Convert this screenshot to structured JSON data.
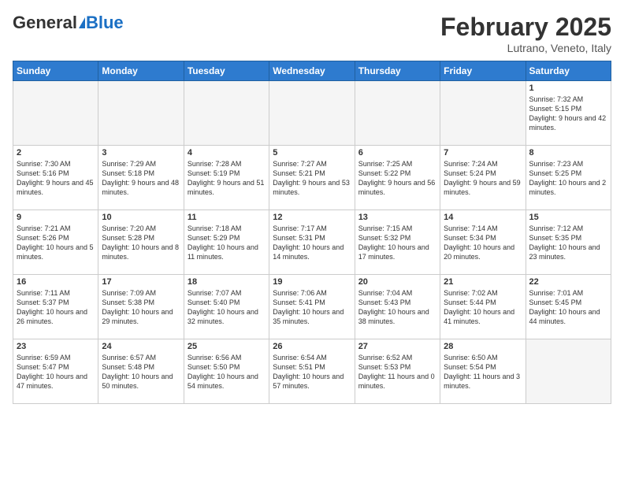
{
  "header": {
    "logo_general": "General",
    "logo_blue": "Blue",
    "month": "February 2025",
    "location": "Lutrano, Veneto, Italy"
  },
  "weekdays": [
    "Sunday",
    "Monday",
    "Tuesday",
    "Wednesday",
    "Thursday",
    "Friday",
    "Saturday"
  ],
  "weeks": [
    [
      {
        "day": "",
        "sunrise": "",
        "sunset": "",
        "daylight": ""
      },
      {
        "day": "",
        "sunrise": "",
        "sunset": "",
        "daylight": ""
      },
      {
        "day": "",
        "sunrise": "",
        "sunset": "",
        "daylight": ""
      },
      {
        "day": "",
        "sunrise": "",
        "sunset": "",
        "daylight": ""
      },
      {
        "day": "",
        "sunrise": "",
        "sunset": "",
        "daylight": ""
      },
      {
        "day": "",
        "sunrise": "",
        "sunset": "",
        "daylight": ""
      },
      {
        "day": "1",
        "sunrise": "Sunrise: 7:32 AM",
        "sunset": "Sunset: 5:15 PM",
        "daylight": "Daylight: 9 hours and 42 minutes."
      }
    ],
    [
      {
        "day": "2",
        "sunrise": "Sunrise: 7:30 AM",
        "sunset": "Sunset: 5:16 PM",
        "daylight": "Daylight: 9 hours and 45 minutes."
      },
      {
        "day": "3",
        "sunrise": "Sunrise: 7:29 AM",
        "sunset": "Sunset: 5:18 PM",
        "daylight": "Daylight: 9 hours and 48 minutes."
      },
      {
        "day": "4",
        "sunrise": "Sunrise: 7:28 AM",
        "sunset": "Sunset: 5:19 PM",
        "daylight": "Daylight: 9 hours and 51 minutes."
      },
      {
        "day": "5",
        "sunrise": "Sunrise: 7:27 AM",
        "sunset": "Sunset: 5:21 PM",
        "daylight": "Daylight: 9 hours and 53 minutes."
      },
      {
        "day": "6",
        "sunrise": "Sunrise: 7:25 AM",
        "sunset": "Sunset: 5:22 PM",
        "daylight": "Daylight: 9 hours and 56 minutes."
      },
      {
        "day": "7",
        "sunrise": "Sunrise: 7:24 AM",
        "sunset": "Sunset: 5:24 PM",
        "daylight": "Daylight: 9 hours and 59 minutes."
      },
      {
        "day": "8",
        "sunrise": "Sunrise: 7:23 AM",
        "sunset": "Sunset: 5:25 PM",
        "daylight": "Daylight: 10 hours and 2 minutes."
      }
    ],
    [
      {
        "day": "9",
        "sunrise": "Sunrise: 7:21 AM",
        "sunset": "Sunset: 5:26 PM",
        "daylight": "Daylight: 10 hours and 5 minutes."
      },
      {
        "day": "10",
        "sunrise": "Sunrise: 7:20 AM",
        "sunset": "Sunset: 5:28 PM",
        "daylight": "Daylight: 10 hours and 8 minutes."
      },
      {
        "day": "11",
        "sunrise": "Sunrise: 7:18 AM",
        "sunset": "Sunset: 5:29 PM",
        "daylight": "Daylight: 10 hours and 11 minutes."
      },
      {
        "day": "12",
        "sunrise": "Sunrise: 7:17 AM",
        "sunset": "Sunset: 5:31 PM",
        "daylight": "Daylight: 10 hours and 14 minutes."
      },
      {
        "day": "13",
        "sunrise": "Sunrise: 7:15 AM",
        "sunset": "Sunset: 5:32 PM",
        "daylight": "Daylight: 10 hours and 17 minutes."
      },
      {
        "day": "14",
        "sunrise": "Sunrise: 7:14 AM",
        "sunset": "Sunset: 5:34 PM",
        "daylight": "Daylight: 10 hours and 20 minutes."
      },
      {
        "day": "15",
        "sunrise": "Sunrise: 7:12 AM",
        "sunset": "Sunset: 5:35 PM",
        "daylight": "Daylight: 10 hours and 23 minutes."
      }
    ],
    [
      {
        "day": "16",
        "sunrise": "Sunrise: 7:11 AM",
        "sunset": "Sunset: 5:37 PM",
        "daylight": "Daylight: 10 hours and 26 minutes."
      },
      {
        "day": "17",
        "sunrise": "Sunrise: 7:09 AM",
        "sunset": "Sunset: 5:38 PM",
        "daylight": "Daylight: 10 hours and 29 minutes."
      },
      {
        "day": "18",
        "sunrise": "Sunrise: 7:07 AM",
        "sunset": "Sunset: 5:40 PM",
        "daylight": "Daylight: 10 hours and 32 minutes."
      },
      {
        "day": "19",
        "sunrise": "Sunrise: 7:06 AM",
        "sunset": "Sunset: 5:41 PM",
        "daylight": "Daylight: 10 hours and 35 minutes."
      },
      {
        "day": "20",
        "sunrise": "Sunrise: 7:04 AM",
        "sunset": "Sunset: 5:43 PM",
        "daylight": "Daylight: 10 hours and 38 minutes."
      },
      {
        "day": "21",
        "sunrise": "Sunrise: 7:02 AM",
        "sunset": "Sunset: 5:44 PM",
        "daylight": "Daylight: 10 hours and 41 minutes."
      },
      {
        "day": "22",
        "sunrise": "Sunrise: 7:01 AM",
        "sunset": "Sunset: 5:45 PM",
        "daylight": "Daylight: 10 hours and 44 minutes."
      }
    ],
    [
      {
        "day": "23",
        "sunrise": "Sunrise: 6:59 AM",
        "sunset": "Sunset: 5:47 PM",
        "daylight": "Daylight: 10 hours and 47 minutes."
      },
      {
        "day": "24",
        "sunrise": "Sunrise: 6:57 AM",
        "sunset": "Sunset: 5:48 PM",
        "daylight": "Daylight: 10 hours and 50 minutes."
      },
      {
        "day": "25",
        "sunrise": "Sunrise: 6:56 AM",
        "sunset": "Sunset: 5:50 PM",
        "daylight": "Daylight: 10 hours and 54 minutes."
      },
      {
        "day": "26",
        "sunrise": "Sunrise: 6:54 AM",
        "sunset": "Sunset: 5:51 PM",
        "daylight": "Daylight: 10 hours and 57 minutes."
      },
      {
        "day": "27",
        "sunrise": "Sunrise: 6:52 AM",
        "sunset": "Sunset: 5:53 PM",
        "daylight": "Daylight: 11 hours and 0 minutes."
      },
      {
        "day": "28",
        "sunrise": "Sunrise: 6:50 AM",
        "sunset": "Sunset: 5:54 PM",
        "daylight": "Daylight: 11 hours and 3 minutes."
      },
      {
        "day": "",
        "sunrise": "",
        "sunset": "",
        "daylight": ""
      }
    ]
  ]
}
